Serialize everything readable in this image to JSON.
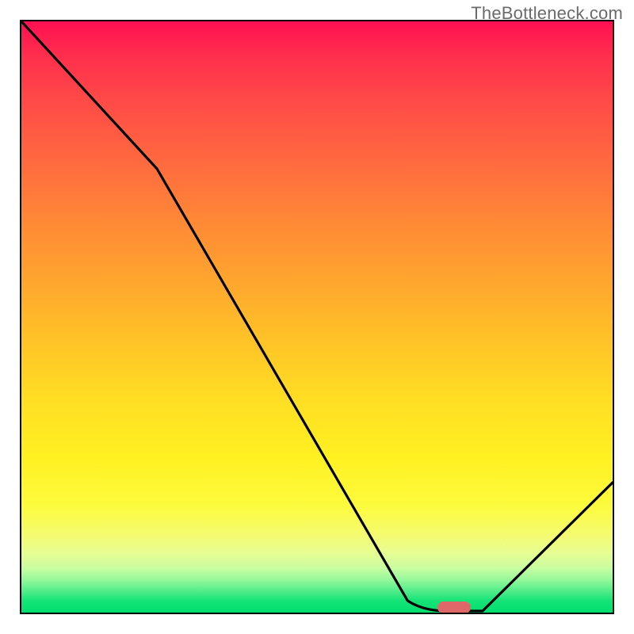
{
  "watermark": "TheBottleneck.com",
  "chart_data": {
    "type": "line",
    "title": "",
    "xlabel": "",
    "ylabel": "",
    "xlim": [
      0,
      100
    ],
    "ylim": [
      0,
      100
    ],
    "grid": false,
    "legend": false,
    "background": "vertical red-to-green gradient",
    "series": [
      {
        "name": "bottleneck-curve",
        "x": [
          0,
          23,
          65,
          72,
          78,
          100
        ],
        "y": [
          100,
          75,
          2,
          0,
          0,
          22
        ]
      }
    ],
    "marker": {
      "name": "optimal-band",
      "x_start": 70,
      "x_end": 76,
      "y": 0
    },
    "gradient_stops": [
      {
        "pos": 0,
        "color": "#ff1051"
      },
      {
        "pos": 50,
        "color": "#ffb52a"
      },
      {
        "pos": 80,
        "color": "#fcf93a"
      },
      {
        "pos": 100,
        "color": "#00de70"
      }
    ]
  }
}
